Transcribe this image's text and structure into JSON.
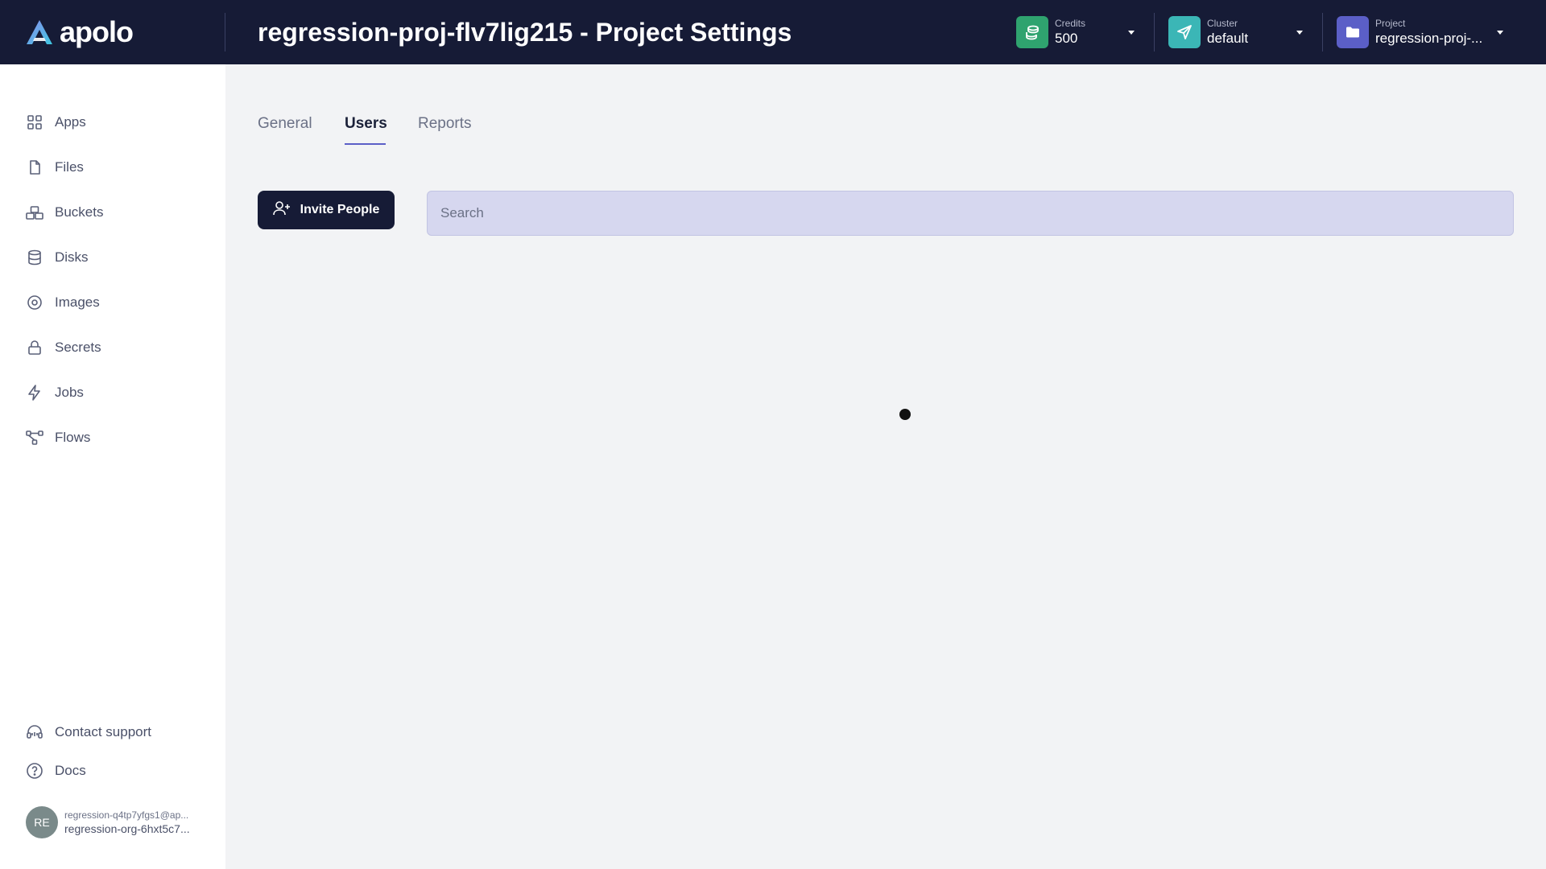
{
  "header": {
    "brand": "apolo",
    "title": "regression-proj-flv7lig215 - Project Settings",
    "credits": {
      "label": "Credits",
      "value": "500",
      "icon": "coins-icon",
      "color": "#2fa36f"
    },
    "cluster": {
      "label": "Cluster",
      "value": "default",
      "icon": "send-icon",
      "color": "#3bb6b6"
    },
    "project": {
      "label": "Project",
      "value": "regression-proj-...",
      "icon": "folder-icon",
      "color": "#5b5fc7"
    }
  },
  "sidebar": {
    "items": [
      {
        "label": "Apps",
        "icon": "apps-grid-icon"
      },
      {
        "label": "Files",
        "icon": "file-icon"
      },
      {
        "label": "Buckets",
        "icon": "buckets-icon"
      },
      {
        "label": "Disks",
        "icon": "database-icon"
      },
      {
        "label": "Images",
        "icon": "image-disc-icon"
      },
      {
        "label": "Secrets",
        "icon": "lock-icon"
      },
      {
        "label": "Jobs",
        "icon": "lightning-icon"
      },
      {
        "label": "Flows",
        "icon": "flows-icon"
      }
    ],
    "footer": [
      {
        "label": "Contact support",
        "icon": "headset-icon"
      },
      {
        "label": "Docs",
        "icon": "help-circle-icon"
      }
    ],
    "user": {
      "initials": "RE",
      "email": "regression-q4tp7yfgs1@ap...",
      "org": "regression-org-6hxt5c7..."
    }
  },
  "main": {
    "tabs": [
      {
        "label": "General",
        "active": false
      },
      {
        "label": "Users",
        "active": true
      },
      {
        "label": "Reports",
        "active": false
      }
    ],
    "invite_label": "Invite People",
    "search": {
      "placeholder": "Search",
      "value": ""
    }
  },
  "colors": {
    "header_bg": "#161b36",
    "accent": "#5b5fc7",
    "search_bg": "#d6d7ef"
  }
}
